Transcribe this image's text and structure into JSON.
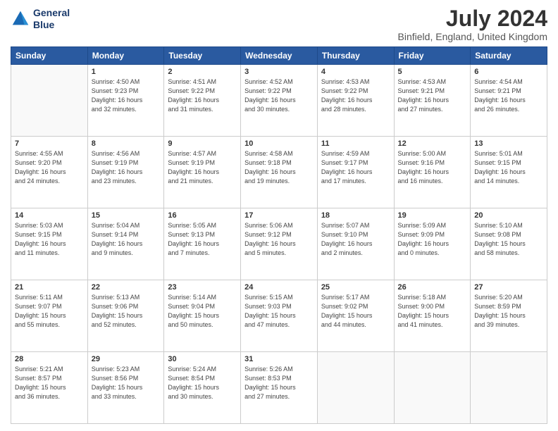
{
  "header": {
    "logo_line1": "General",
    "logo_line2": "Blue",
    "month_year": "July 2024",
    "location": "Binfield, England, United Kingdom"
  },
  "days_of_week": [
    "Sunday",
    "Monday",
    "Tuesday",
    "Wednesday",
    "Thursday",
    "Friday",
    "Saturday"
  ],
  "weeks": [
    [
      {
        "day": "",
        "info": ""
      },
      {
        "day": "1",
        "info": "Sunrise: 4:50 AM\nSunset: 9:23 PM\nDaylight: 16 hours\nand 32 minutes."
      },
      {
        "day": "2",
        "info": "Sunrise: 4:51 AM\nSunset: 9:22 PM\nDaylight: 16 hours\nand 31 minutes."
      },
      {
        "day": "3",
        "info": "Sunrise: 4:52 AM\nSunset: 9:22 PM\nDaylight: 16 hours\nand 30 minutes."
      },
      {
        "day": "4",
        "info": "Sunrise: 4:53 AM\nSunset: 9:22 PM\nDaylight: 16 hours\nand 28 minutes."
      },
      {
        "day": "5",
        "info": "Sunrise: 4:53 AM\nSunset: 9:21 PM\nDaylight: 16 hours\nand 27 minutes."
      },
      {
        "day": "6",
        "info": "Sunrise: 4:54 AM\nSunset: 9:21 PM\nDaylight: 16 hours\nand 26 minutes."
      }
    ],
    [
      {
        "day": "7",
        "info": "Sunrise: 4:55 AM\nSunset: 9:20 PM\nDaylight: 16 hours\nand 24 minutes."
      },
      {
        "day": "8",
        "info": "Sunrise: 4:56 AM\nSunset: 9:19 PM\nDaylight: 16 hours\nand 23 minutes."
      },
      {
        "day": "9",
        "info": "Sunrise: 4:57 AM\nSunset: 9:19 PM\nDaylight: 16 hours\nand 21 minutes."
      },
      {
        "day": "10",
        "info": "Sunrise: 4:58 AM\nSunset: 9:18 PM\nDaylight: 16 hours\nand 19 minutes."
      },
      {
        "day": "11",
        "info": "Sunrise: 4:59 AM\nSunset: 9:17 PM\nDaylight: 16 hours\nand 17 minutes."
      },
      {
        "day": "12",
        "info": "Sunrise: 5:00 AM\nSunset: 9:16 PM\nDaylight: 16 hours\nand 16 minutes."
      },
      {
        "day": "13",
        "info": "Sunrise: 5:01 AM\nSunset: 9:15 PM\nDaylight: 16 hours\nand 14 minutes."
      }
    ],
    [
      {
        "day": "14",
        "info": "Sunrise: 5:03 AM\nSunset: 9:15 PM\nDaylight: 16 hours\nand 11 minutes."
      },
      {
        "day": "15",
        "info": "Sunrise: 5:04 AM\nSunset: 9:14 PM\nDaylight: 16 hours\nand 9 minutes."
      },
      {
        "day": "16",
        "info": "Sunrise: 5:05 AM\nSunset: 9:13 PM\nDaylight: 16 hours\nand 7 minutes."
      },
      {
        "day": "17",
        "info": "Sunrise: 5:06 AM\nSunset: 9:12 PM\nDaylight: 16 hours\nand 5 minutes."
      },
      {
        "day": "18",
        "info": "Sunrise: 5:07 AM\nSunset: 9:10 PM\nDaylight: 16 hours\nand 2 minutes."
      },
      {
        "day": "19",
        "info": "Sunrise: 5:09 AM\nSunset: 9:09 PM\nDaylight: 16 hours\nand 0 minutes."
      },
      {
        "day": "20",
        "info": "Sunrise: 5:10 AM\nSunset: 9:08 PM\nDaylight: 15 hours\nand 58 minutes."
      }
    ],
    [
      {
        "day": "21",
        "info": "Sunrise: 5:11 AM\nSunset: 9:07 PM\nDaylight: 15 hours\nand 55 minutes."
      },
      {
        "day": "22",
        "info": "Sunrise: 5:13 AM\nSunset: 9:06 PM\nDaylight: 15 hours\nand 52 minutes."
      },
      {
        "day": "23",
        "info": "Sunrise: 5:14 AM\nSunset: 9:04 PM\nDaylight: 15 hours\nand 50 minutes."
      },
      {
        "day": "24",
        "info": "Sunrise: 5:15 AM\nSunset: 9:03 PM\nDaylight: 15 hours\nand 47 minutes."
      },
      {
        "day": "25",
        "info": "Sunrise: 5:17 AM\nSunset: 9:02 PM\nDaylight: 15 hours\nand 44 minutes."
      },
      {
        "day": "26",
        "info": "Sunrise: 5:18 AM\nSunset: 9:00 PM\nDaylight: 15 hours\nand 41 minutes."
      },
      {
        "day": "27",
        "info": "Sunrise: 5:20 AM\nSunset: 8:59 PM\nDaylight: 15 hours\nand 39 minutes."
      }
    ],
    [
      {
        "day": "28",
        "info": "Sunrise: 5:21 AM\nSunset: 8:57 PM\nDaylight: 15 hours\nand 36 minutes."
      },
      {
        "day": "29",
        "info": "Sunrise: 5:23 AM\nSunset: 8:56 PM\nDaylight: 15 hours\nand 33 minutes."
      },
      {
        "day": "30",
        "info": "Sunrise: 5:24 AM\nSunset: 8:54 PM\nDaylight: 15 hours\nand 30 minutes."
      },
      {
        "day": "31",
        "info": "Sunrise: 5:26 AM\nSunset: 8:53 PM\nDaylight: 15 hours\nand 27 minutes."
      },
      {
        "day": "",
        "info": ""
      },
      {
        "day": "",
        "info": ""
      },
      {
        "day": "",
        "info": ""
      }
    ]
  ]
}
